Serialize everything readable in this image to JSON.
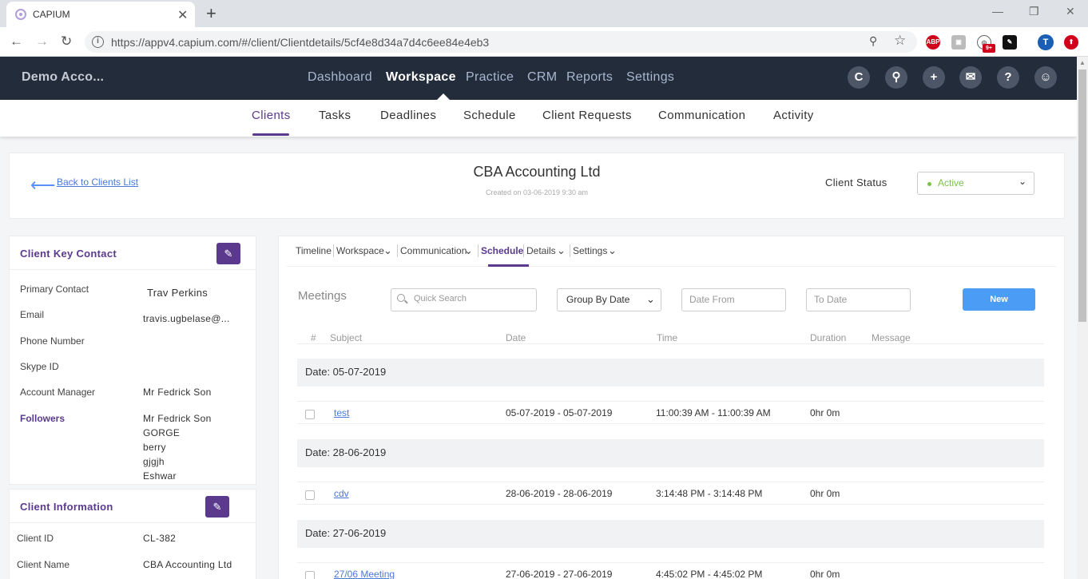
{
  "browser": {
    "tab_title": "CAPIUM",
    "url": "https://appv4.capium.com/#/client/Clientdetails/5cf4e8d34a7d4c6ee84e4eb3",
    "ext_badge": "9+"
  },
  "app": {
    "org_name": "Demo Acco...",
    "main_nav": [
      "Dashboard",
      "Workspace",
      "Practice",
      "CRM",
      "Reports",
      "Settings"
    ],
    "sub_nav": [
      "Clients",
      "Tasks",
      "Deadlines",
      "Schedule",
      "Client Requests",
      "Communication",
      "Activity"
    ],
    "user_initial": "T"
  },
  "client": {
    "back_label": "Back to Clients List",
    "name": "CBA Accounting Ltd",
    "created": "Created on 03-06-2019 9:30 am",
    "status_label": "Client Status",
    "status_value": "Active",
    "status_color": "#7cc242"
  },
  "key_contact": {
    "title": "Client Key Contact",
    "rows": [
      {
        "label": "Primary Contact",
        "value": "Trav Perkins"
      },
      {
        "label": "Email",
        "value": "travis.ugbelase@..."
      },
      {
        "label": "Phone Number",
        "value": ""
      },
      {
        "label": "Skype ID",
        "value": ""
      },
      {
        "label": "Account Manager",
        "value": "Mr Fedrick Son"
      }
    ],
    "followers_label": "Followers",
    "followers": [
      "Mr Fedrick Son",
      "GORGE",
      "berry",
      "gjgjh",
      "Eshwar"
    ]
  },
  "client_info": {
    "title": "Client Information",
    "rows": [
      {
        "label": "Client ID",
        "value": "CL-382"
      },
      {
        "label": "Client Name",
        "value": "CBA Accounting Ltd"
      }
    ]
  },
  "main": {
    "tabs": [
      "Timeline",
      "Workspace",
      "Communication",
      "Schedule",
      "Details",
      "Settings"
    ],
    "section_title": "Meetings",
    "search_placeholder": "Quick Search",
    "group_by": "Group By Date",
    "date_from": "Date From",
    "to_date": "To Date",
    "new_label": "New",
    "columns": [
      "#",
      "Subject",
      "Date",
      "Time",
      "Duration",
      "Message"
    ],
    "groups": [
      {
        "label": "Date: 05-07-2019",
        "rows": [
          {
            "subject": "test",
            "date": "05-07-2019 - 05-07-2019",
            "time": "11:00:39 AM - 11:00:39 AM",
            "duration": "0hr 0m"
          }
        ]
      },
      {
        "label": "Date: 28-06-2019",
        "rows": [
          {
            "subject": "cdv",
            "date": "28-06-2019 - 28-06-2019",
            "time": "3:14:48 PM - 3:14:48 PM",
            "duration": "0hr 0m"
          }
        ]
      },
      {
        "label": "Date: 27-06-2019",
        "rows": [
          {
            "subject": "27/06 Meeting",
            "date": "27-06-2019 - 27-06-2019",
            "time": "4:45:02 PM - 4:45:02 PM",
            "duration": "0hr 0m"
          }
        ]
      }
    ]
  },
  "colors": {
    "brand_purple": "#5b3a8e",
    "header_dark": "#232c3b",
    "new_button": "#4a9cf5"
  }
}
